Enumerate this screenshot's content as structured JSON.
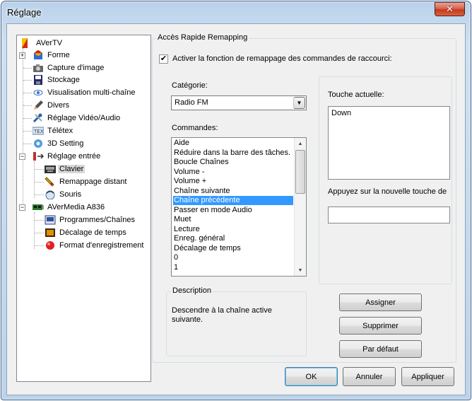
{
  "window": {
    "title": "Réglage",
    "close_glyph": "✕"
  },
  "tree": {
    "items": [
      {
        "label": "AVerTV",
        "icon": "avertv-icon",
        "color": "#e8b800"
      },
      {
        "label": "Forme",
        "icon": "skin-icon",
        "color": "#d02020"
      },
      {
        "label": "Capture d'image",
        "icon": "camera-icon",
        "color": "#555555"
      },
      {
        "label": "Stockage",
        "icon": "floppy-disk-icon",
        "color": "#203080"
      },
      {
        "label": "Visualisation multi-chaîne",
        "icon": "eye-icon",
        "color": "#3070c0"
      },
      {
        "label": "Divers",
        "icon": "pencil-icon",
        "color": "#404040"
      },
      {
        "label": "Réglage Vidéo/Audio",
        "icon": "tools-icon",
        "color": "#3a6fc0"
      },
      {
        "label": "Télétex",
        "icon": "teletext-icon",
        "color": "#6080a0"
      },
      {
        "label": "3D Setting",
        "icon": "3d-setting-icon",
        "color": "#4a8fd0"
      },
      {
        "label": "Réglage entrée",
        "icon": "input-settings-icon",
        "color": "#c03030"
      },
      {
        "label": "Clavier",
        "icon": "keyboard-icon",
        "color": "#404040"
      },
      {
        "label": "Remappage distant",
        "icon": "remote-icon",
        "color": "#d09000"
      },
      {
        "label": "Souris",
        "icon": "mouse-icon",
        "color": "#5080b0"
      },
      {
        "label": "AVerMedia A836",
        "icon": "tuner-card-icon",
        "color": "#2a7a2a"
      },
      {
        "label": "Programmes/Chaînes",
        "icon": "channels-icon",
        "color": "#3050a0"
      },
      {
        "label": "Décalage de temps",
        "icon": "timeshift-icon",
        "color": "#c07000"
      },
      {
        "label": "Format d'enregistrement",
        "icon": "record-icon",
        "color": "#e02020"
      }
    ],
    "expand_glyph": "+",
    "collapse_glyph": "−"
  },
  "remap": {
    "group_title": "Accès Rapide Remapping",
    "enable_label": "Activer la fonction de remappage des commandes de raccourci:",
    "enable_checked": "✔",
    "category_label": "Catégorie:",
    "category_value": "Radio FM",
    "commands_label": "Commandes:",
    "commands": [
      "Aide",
      "Réduire dans la barre des tâches.",
      "Boucle Chaînes",
      "Volume -",
      "Volume +",
      "Chaîne suivante",
      "Chaîne précédente",
      "Passer en mode Audio",
      "Muet",
      "Lecture",
      "Enreg. général",
      "Décalage de temps",
      "0",
      "1"
    ],
    "selected_command_index": 6,
    "scroll_up": "▲",
    "scroll_down": "▼",
    "current_key_label": "Touche actuelle:",
    "current_key_value": "Down",
    "new_key_label": "Appuyez sur la nouvelle touche de",
    "new_key_value": "",
    "description_title": "Description",
    "description_text": "Descendre à la chaîne active suivante.",
    "assign_label": "Assigner",
    "delete_label": "Supprimer",
    "default_label": "Par défaut"
  },
  "footer": {
    "ok_label": "OK",
    "cancel_label": "Annuler",
    "apply_label": "Appliquer"
  }
}
